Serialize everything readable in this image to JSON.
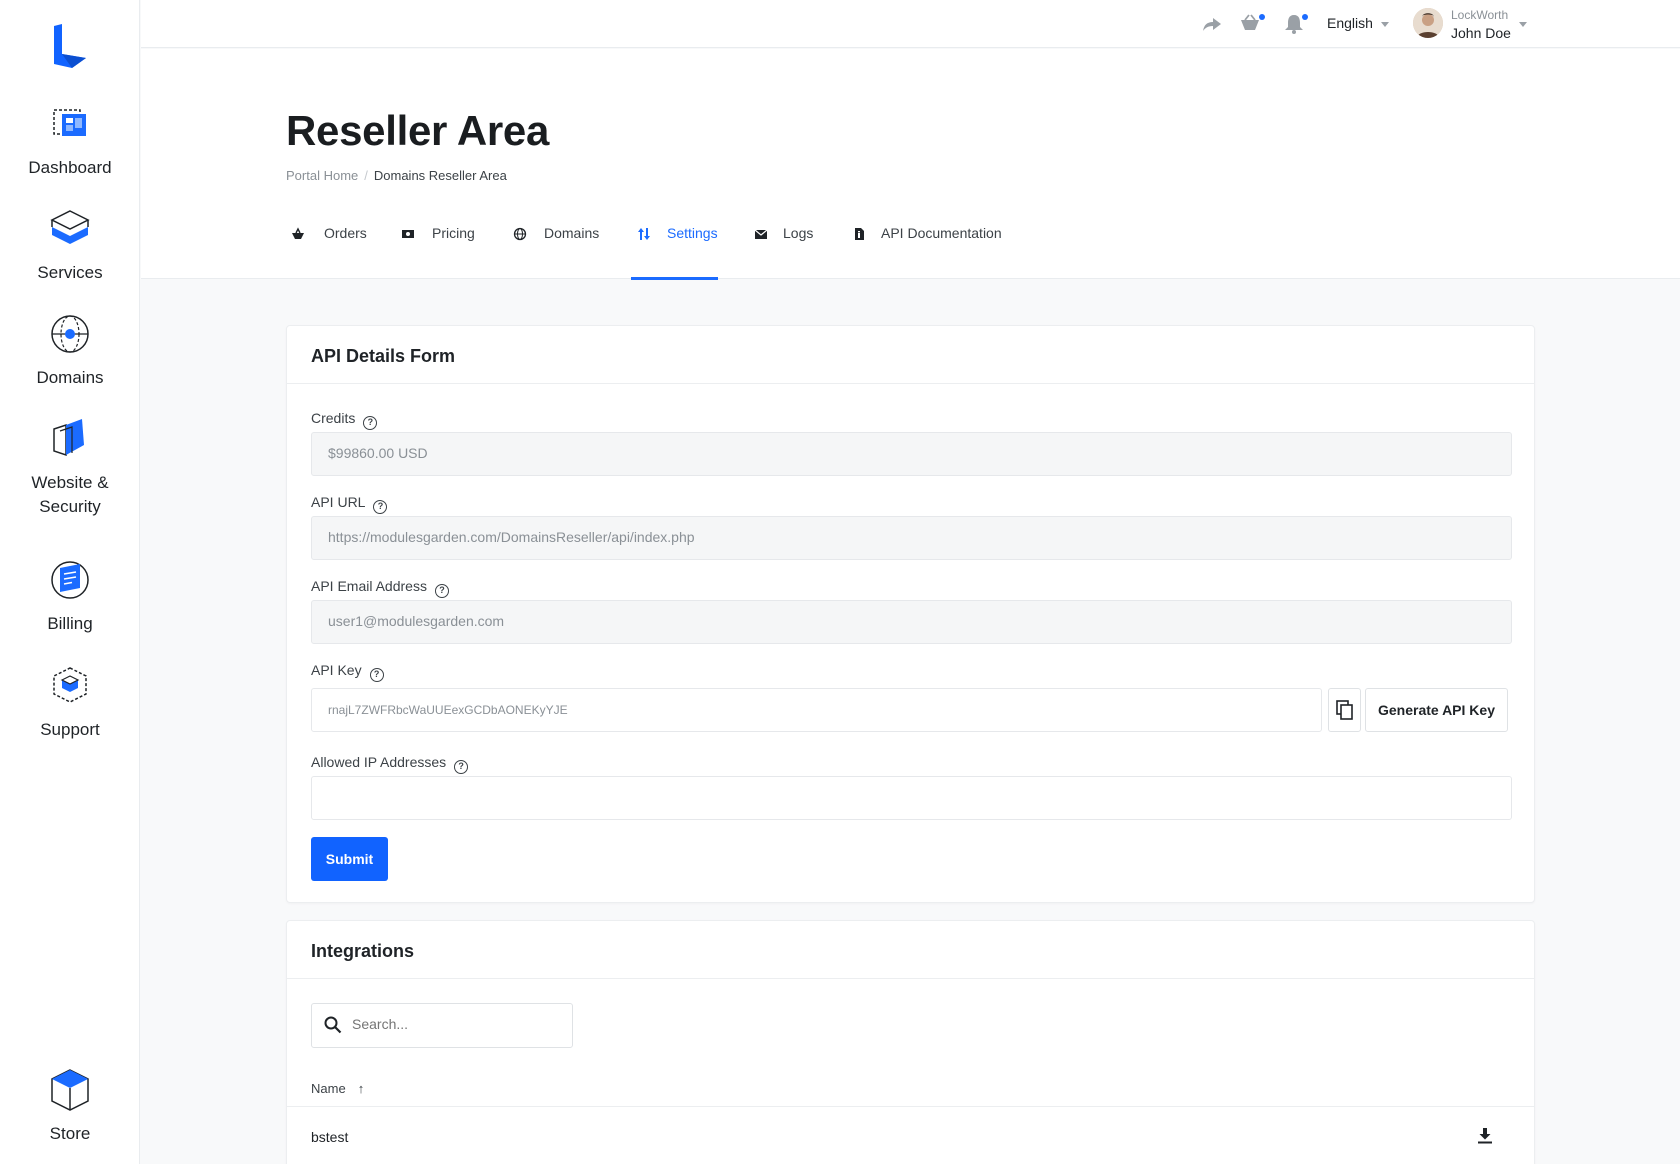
{
  "sidebar": {
    "items": [
      {
        "label": "Dashboard"
      },
      {
        "label": "Services"
      },
      {
        "label": "Domains"
      },
      {
        "label_line1": "Website &",
        "label_line2": "Security"
      },
      {
        "label": "Billing"
      },
      {
        "label": "Support"
      },
      {
        "label": "Store"
      }
    ]
  },
  "topbar": {
    "language": "English",
    "company": "LockWorth",
    "user": "John Doe"
  },
  "header": {
    "title": "Reseller Area",
    "breadcrumb": {
      "home": "Portal Home",
      "current": "Domains Reseller Area"
    },
    "tabs": [
      {
        "label": "Orders",
        "icon": "basket-icon"
      },
      {
        "label": "Pricing",
        "icon": "money-icon"
      },
      {
        "label": "Domains",
        "icon": "globe-icon"
      },
      {
        "label": "Settings",
        "icon": "sort-arrows-icon",
        "active": true
      },
      {
        "label": "Logs",
        "icon": "envelope-icon"
      },
      {
        "label": "API Documentation",
        "icon": "document-icon"
      }
    ]
  },
  "api_form": {
    "title": "API Details Form",
    "credits_label": "Credits",
    "credits_value": "$99860.00 USD",
    "api_url_label": "API URL",
    "api_url_value": "https://modulesgarden.com/DomainsReseller/api/index.php",
    "api_email_label": "API Email Address",
    "api_email_value": "user1@modulesgarden.com",
    "api_key_label": "API Key",
    "api_key_value": "rnajL7ZWFRbcWaUUEexGCDbAONEKyYJE",
    "generate_label": "Generate API Key",
    "allowed_ip_label": "Allowed IP Addresses",
    "allowed_ip_value": "",
    "submit_label": "Submit"
  },
  "integrations": {
    "title": "Integrations",
    "search_placeholder": "Search...",
    "column_name": "Name",
    "rows": [
      {
        "name": "bstest"
      }
    ]
  },
  "colors": {
    "accent": "#1163ff",
    "active_tab": "#1b6bff"
  }
}
